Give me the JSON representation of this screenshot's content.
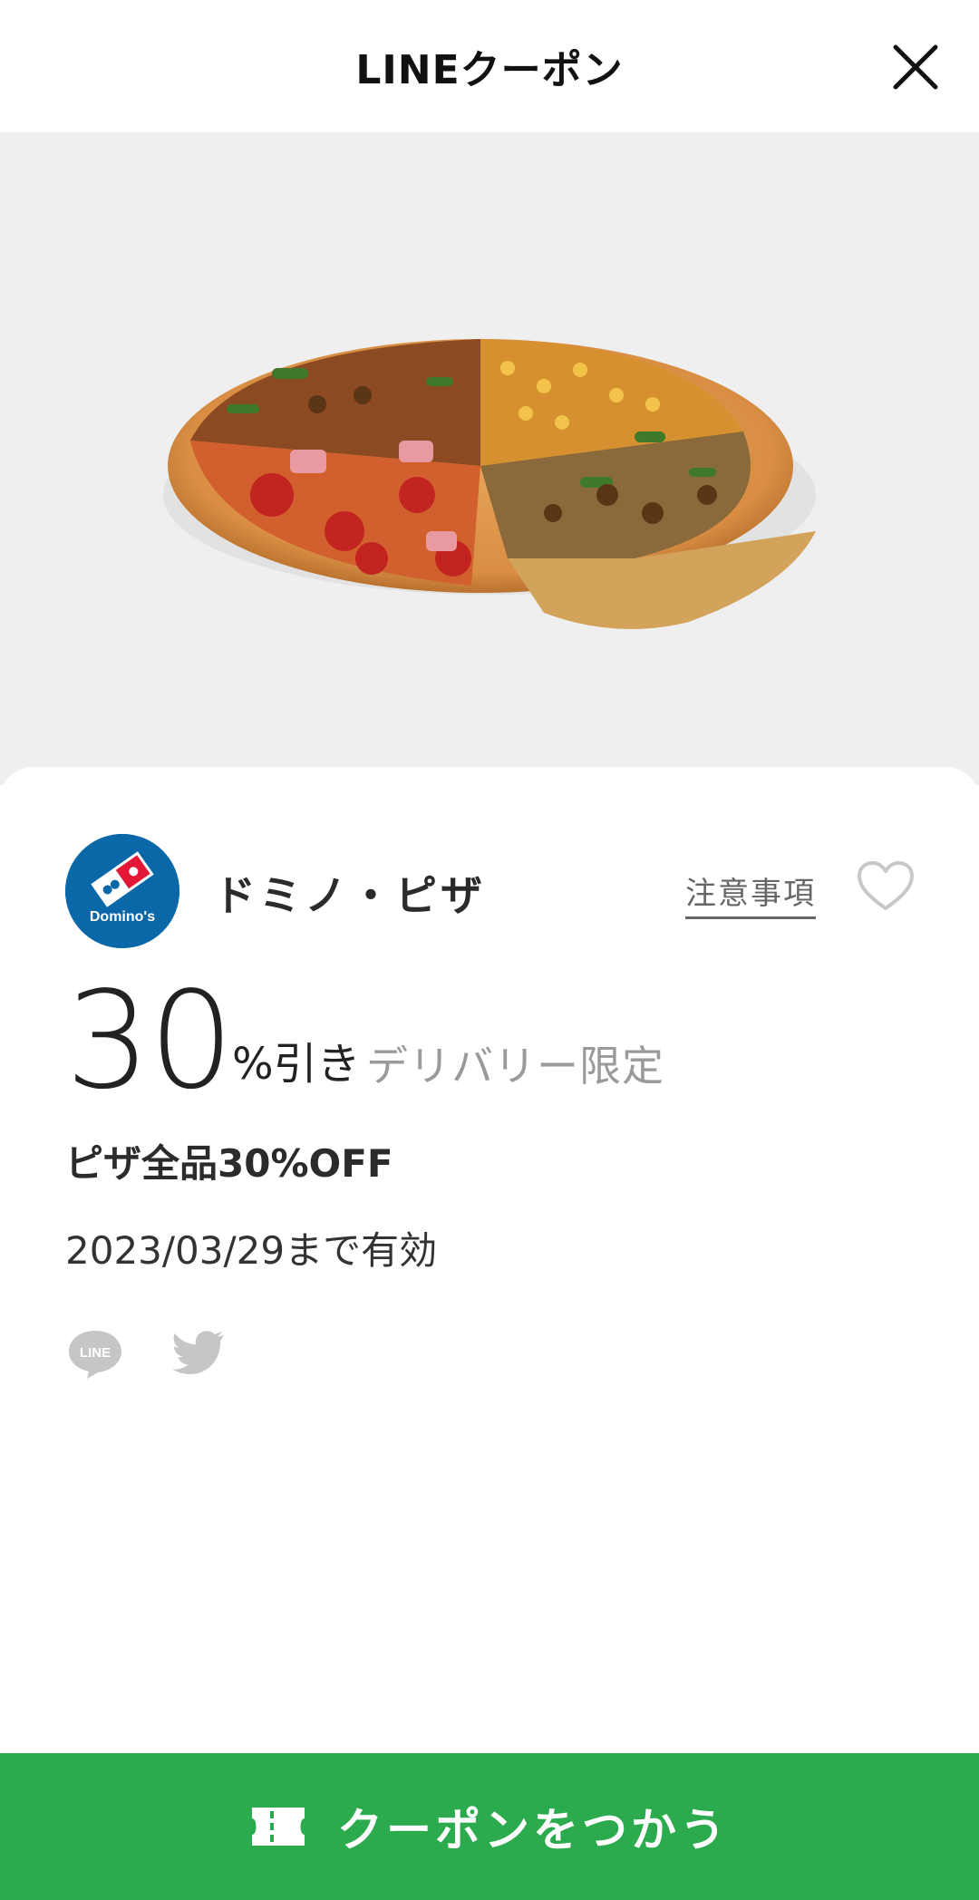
{
  "header": {
    "title": "LINEクーポン",
    "close_icon": "close-icon"
  },
  "hero": {
    "image_alt": "pizza"
  },
  "brand": {
    "name": "ドミノ・ピザ",
    "logo_text": "Domino's",
    "logo_color": "#0b68a8"
  },
  "notes_link": "注意事項",
  "discount": {
    "value": "30",
    "unit": "%引き",
    "condition": "デリバリー限定"
  },
  "coupon_description": "ピザ全品30%OFF",
  "validity": "2023/03/29まで有効",
  "share": {
    "line_label": "LINE",
    "twitter_icon": "twitter-icon"
  },
  "use_button": {
    "label": "クーポンをつかう",
    "color": "#2baa4e"
  }
}
